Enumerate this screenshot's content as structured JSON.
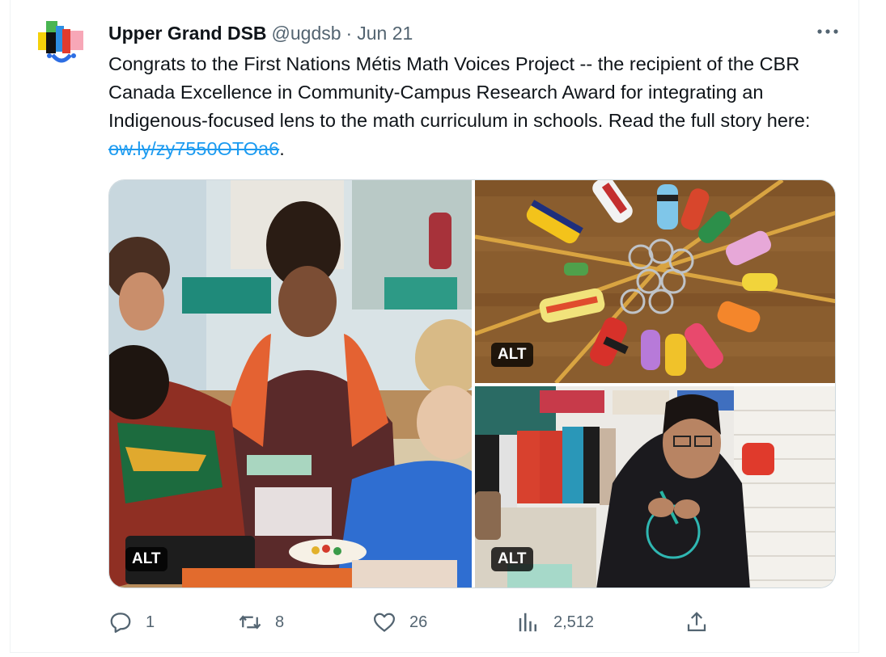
{
  "tweet": {
    "author_name": "Upper Grand DSB",
    "handle": "@ugdsb",
    "separator": "·",
    "date": "Jun 21",
    "text_main": "Congrats to the First Nations Métis Math Voices Project -- the recipient of the CBR Canada Excellence in Community-Campus Research Award for integrating an Indigenous-focused lens to the math curriculum in schools. Read the full story here: ",
    "link": "ow.ly/zy7550OTOa6",
    "text_end": "."
  },
  "media": {
    "alt_label": "ALT"
  },
  "actions": {
    "replies": "1",
    "retweets": "8",
    "likes": "26",
    "views": "2,512"
  },
  "colors": {
    "text_primary": "#0f1419",
    "text_secondary": "#536471",
    "link": "#1d9bf0",
    "border": "#cfd9de"
  },
  "icons": {
    "more": "more-horizontal-icon",
    "reply": "reply-icon",
    "retweet": "retweet-icon",
    "like": "heart-icon",
    "views": "views-chart-icon",
    "share": "share-icon"
  }
}
